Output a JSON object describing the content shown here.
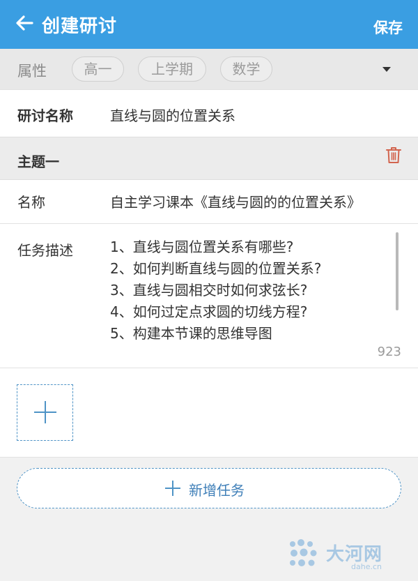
{
  "header": {
    "title": "创建研讨",
    "save_label": "保存",
    "back_icon": "arrow-left-icon",
    "bg_color": "#3a9ee2"
  },
  "attributes": {
    "label": "属性",
    "chips": [
      "高一",
      "上学期",
      "数学"
    ],
    "dropdown_icon": "caret-down-icon"
  },
  "discussion": {
    "name_label": "研讨名称",
    "name_value": "直线与圆的位置关系"
  },
  "topic": {
    "title": "主题一",
    "delete_icon": "trash-icon",
    "name_label": "名称",
    "name_value": "自主学习课本《直线与圆的的位置关系》",
    "desc_label": "任务描述",
    "desc_lines": [
      "1、直线与圆位置关系有哪些?",
      "2、如何判断直线与圆的位置关系?",
      "3、直线与圆相交时如何求弦长?",
      "4、如何过定点求圆的切线方程?",
      "5、构建本节课的思维导图"
    ],
    "char_count": "923",
    "add_attachment_icon": "plus-icon"
  },
  "new_task": {
    "label": "新增任务",
    "icon": "plus-icon",
    "accent_color": "#4e93c6"
  },
  "watermark": {
    "text": "大河网",
    "sub": "dahe.cn"
  }
}
